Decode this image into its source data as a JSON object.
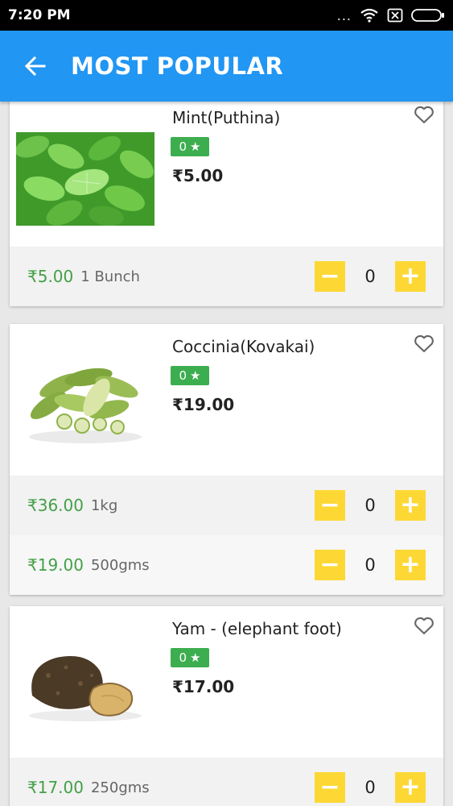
{
  "status_bar": {
    "time": "7:20 PM",
    "dots": "..."
  },
  "app_bar": {
    "title": "MOST POPULAR"
  },
  "products": [
    {
      "name": "Mint(Puthina)",
      "rating": "0",
      "price": "₹5.00",
      "image": "mint-leaves",
      "variants": [
        {
          "price": "₹5.00",
          "unit": "1 Bunch",
          "qty": "0"
        }
      ]
    },
    {
      "name": "Coccinia(Kovakai)",
      "rating": "0",
      "price": "₹19.00",
      "image": "ivy-gourd",
      "variants": [
        {
          "price": "₹36.00",
          "unit": "1kg",
          "qty": "0"
        },
        {
          "price": "₹19.00",
          "unit": "500gms",
          "qty": "0"
        }
      ]
    },
    {
      "name": "Yam - (elephant foot)",
      "rating": "0",
      "price": "₹17.00",
      "image": "elephant-foot-yam",
      "variants": [
        {
          "price": "₹17.00",
          "unit": "250gms",
          "qty": "0"
        }
      ]
    }
  ],
  "stepper": {
    "minus": "−",
    "plus": "+"
  },
  "colors": {
    "app_bar": "#2196f3",
    "rating_badge": "#3cae4f",
    "variant_price": "#43a047",
    "stepper": "#fdd835"
  }
}
